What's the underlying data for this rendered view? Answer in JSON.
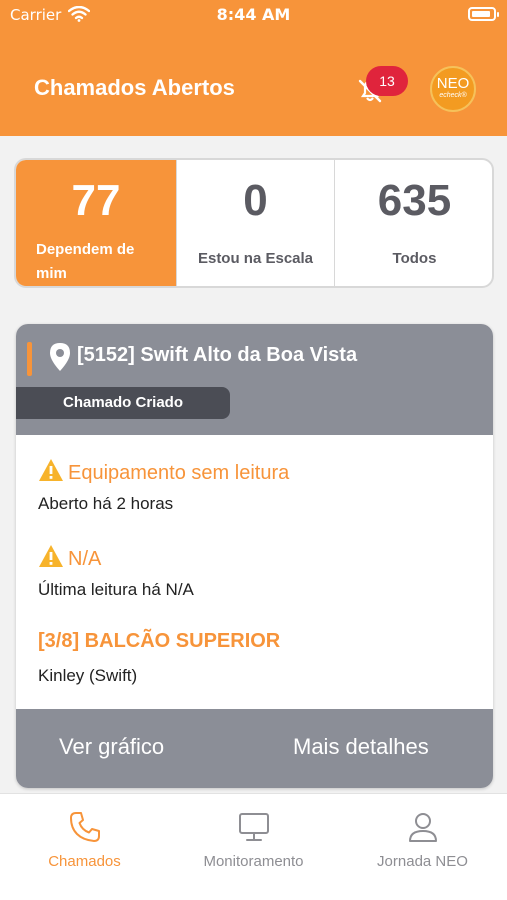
{
  "status_bar": {
    "carrier": "Carrier",
    "time": "8:44 AM"
  },
  "header": {
    "title": "Chamados Abertos",
    "notification_count": "13",
    "logo_text": "NEO",
    "logo_subtext": "echeck®",
    "accent_color": "#f7943a",
    "badge_color": "#e0243c"
  },
  "stats": [
    {
      "value": "77",
      "label": "Dependem de mim",
      "active": true
    },
    {
      "value": "0",
      "label": "Estou na Escala",
      "active": false
    },
    {
      "value": "635",
      "label": "Todos",
      "active": false
    }
  ],
  "ticket": {
    "location": "[5152] Swift Alto da Boa Vista",
    "status": "Chamado Criado",
    "alerts": [
      {
        "title": "Equipamento sem leitura",
        "description": "Aberto há 2 horas",
        "icon": "warning-icon"
      },
      {
        "title": "N/A",
        "description": "Última leitura há N/A",
        "icon": "warning-icon"
      },
      {
        "title": "[3/8] BALCÃO SUPERIOR",
        "description": "Kinley (Swift)"
      }
    ],
    "actions": {
      "chart": "Ver gráfico",
      "details": "Mais detalhes"
    }
  },
  "tabbar": [
    {
      "label": "Chamados",
      "icon": "phone-icon",
      "active": true
    },
    {
      "label": "Monitoramento",
      "icon": "monitor-icon",
      "active": false
    },
    {
      "label": "Jornada NEO",
      "icon": "user-icon",
      "active": false
    }
  ]
}
